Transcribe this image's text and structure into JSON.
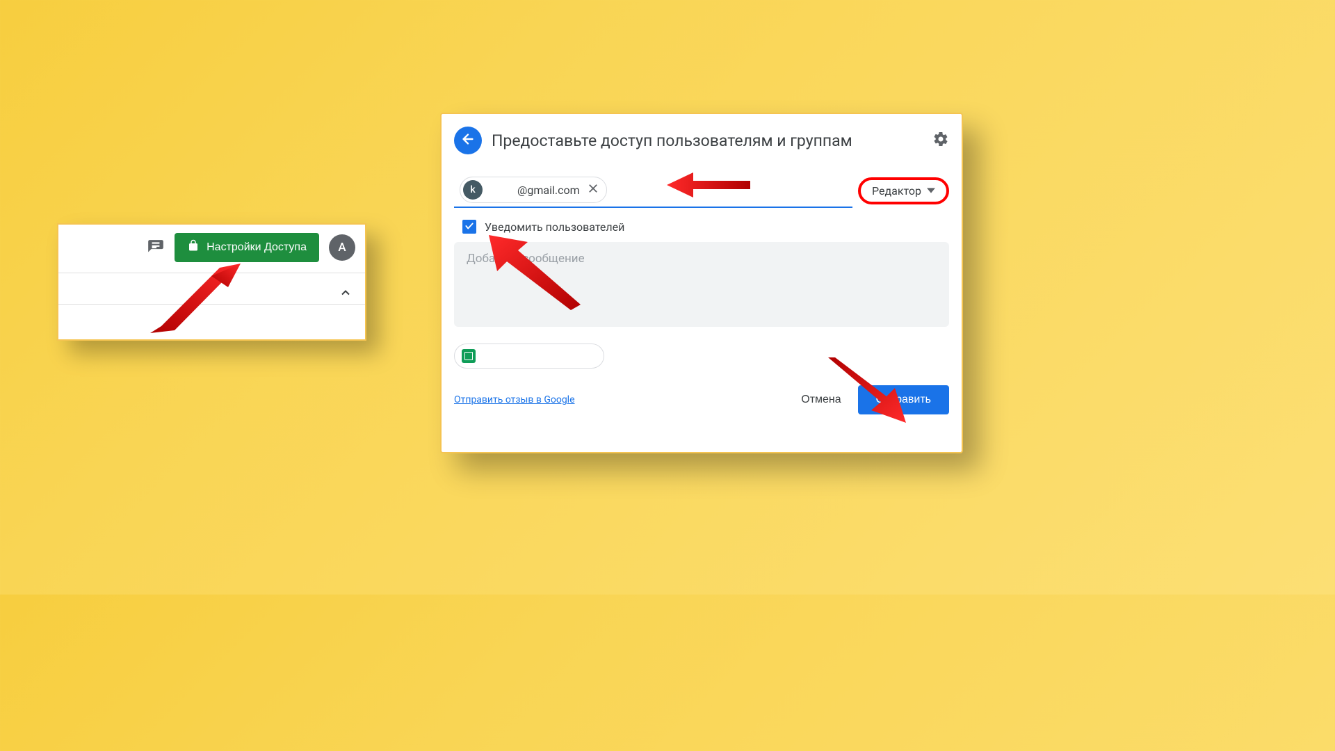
{
  "snippet": {
    "share_label": "Настройки Доступа",
    "avatar_initial": "A"
  },
  "dialog": {
    "title": "Предоставьте доступ пользователям и группам",
    "chip_avatar": "k",
    "chip_email": "@gmail.com",
    "role_label": "Редактор",
    "notify_label": "Уведомить пользователей",
    "message_placeholder": "Добавьте сообщение",
    "feedback_link": "Отправить отзыв в Google",
    "cancel_label": "Отмена",
    "send_label": "Отправить"
  }
}
